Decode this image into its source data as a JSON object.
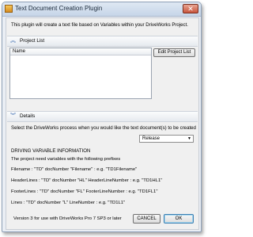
{
  "window": {
    "title": "Text Document Creation Plugin",
    "close_glyph": "✕"
  },
  "intro_text": "This plugin will create a text file based on Variables within your DriveWorks Project.",
  "project_list": {
    "section_label": "Project List",
    "section_icon": "collapse-chevron-icon",
    "column_header": "Name",
    "edit_button": "Edit Project List"
  },
  "details": {
    "section_label": "Details",
    "section_icon": "expand-chevron-icon",
    "process_question": "Select the DriveWorks process when you would like the text document(s) to be created",
    "process_value": "Release",
    "heading": "DRIVING VARIABLE INFORMATION",
    "prefix_intro": "The project need variables with the following prefixes",
    "lines": [
      "Filename : \"TD\"  docNumber  \"Filename\" : e.g. \"TD1Filename\"",
      "HeaderLines : \"TD\"  docNumber  \"HL\"   HeaderLineNumber : e.g. \"TD1HL1\"",
      "FooterLines : \"TD\"  docNumber  \"FL\"   FooterLineNumber : e.g. \"TD1FL1\"",
      "Lines : \"TD\"  docNumber  \"L\"   LineNumber : e.g. \"TD1L1\""
    ]
  },
  "footer": {
    "version_text": "Version 3 for use with DriveWorks Pro 7 SP3 or later",
    "cancel_label": "CANCEL",
    "ok_label": "OK"
  }
}
